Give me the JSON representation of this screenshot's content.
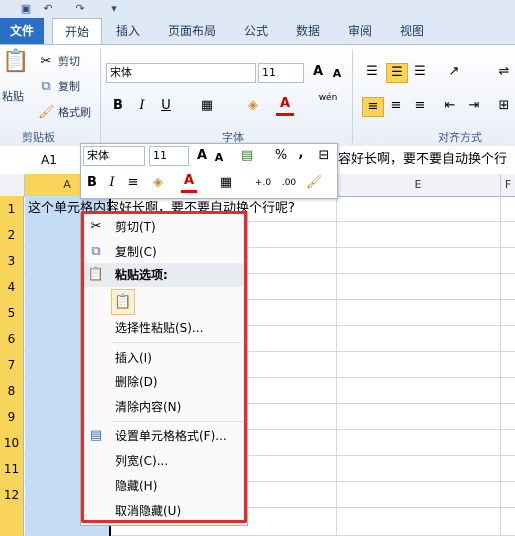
{
  "tabs": [
    "文件",
    "开始",
    "插入",
    "页面布局",
    "公式",
    "数据",
    "审阅",
    "视图"
  ],
  "clipboard": {
    "paste": "粘贴",
    "cut": "剪切",
    "copy": "复制",
    "format_painter": "格式刷",
    "group": "剪贴板"
  },
  "font": {
    "name": "宋体",
    "size": "11",
    "group": "字体",
    "bold": "B",
    "italic": "I",
    "underline": "U",
    "grow": "A",
    "shrink": "A",
    "wen": "wén"
  },
  "alignment": {
    "group": "对齐方式"
  },
  "formula_bar": {
    "name_box": "A1",
    "content": "容好长啊，要不要自动换个行"
  },
  "columns": [
    "A",
    "E",
    "F"
  ],
  "rows": [
    "1",
    "2",
    "3",
    "4",
    "5",
    "6",
    "7",
    "8",
    "9",
    "10",
    "11",
    "12"
  ],
  "cell_a1": "这个单元格内容好长啊，要不要自动换个行呢?",
  "mini_toolbar": {
    "font": "宋体",
    "size": "11",
    "percent": "%",
    "comma": ",",
    "bold": "B",
    "italic": "I",
    "inc_decimal": "+.0",
    "dec_decimal": ".00"
  },
  "context_menu": {
    "cut": "剪切(T)",
    "copy": "复制(C)",
    "paste_options": "粘贴选项:",
    "paste_special": "选择性粘贴(S)...",
    "insert": "插入(I)",
    "delete": "删除(D)",
    "clear": "清除内容(N)",
    "format_cells": "设置单元格格式(F)...",
    "column_width": "列宽(C)...",
    "hide": "隐藏(H)",
    "unhide": "取消隐藏(U)"
  },
  "colors": {
    "accent": "#2a6fc4",
    "highlight": "#c5dcf5",
    "row_header": "#f9d45a",
    "frame": "#e62b2b"
  }
}
